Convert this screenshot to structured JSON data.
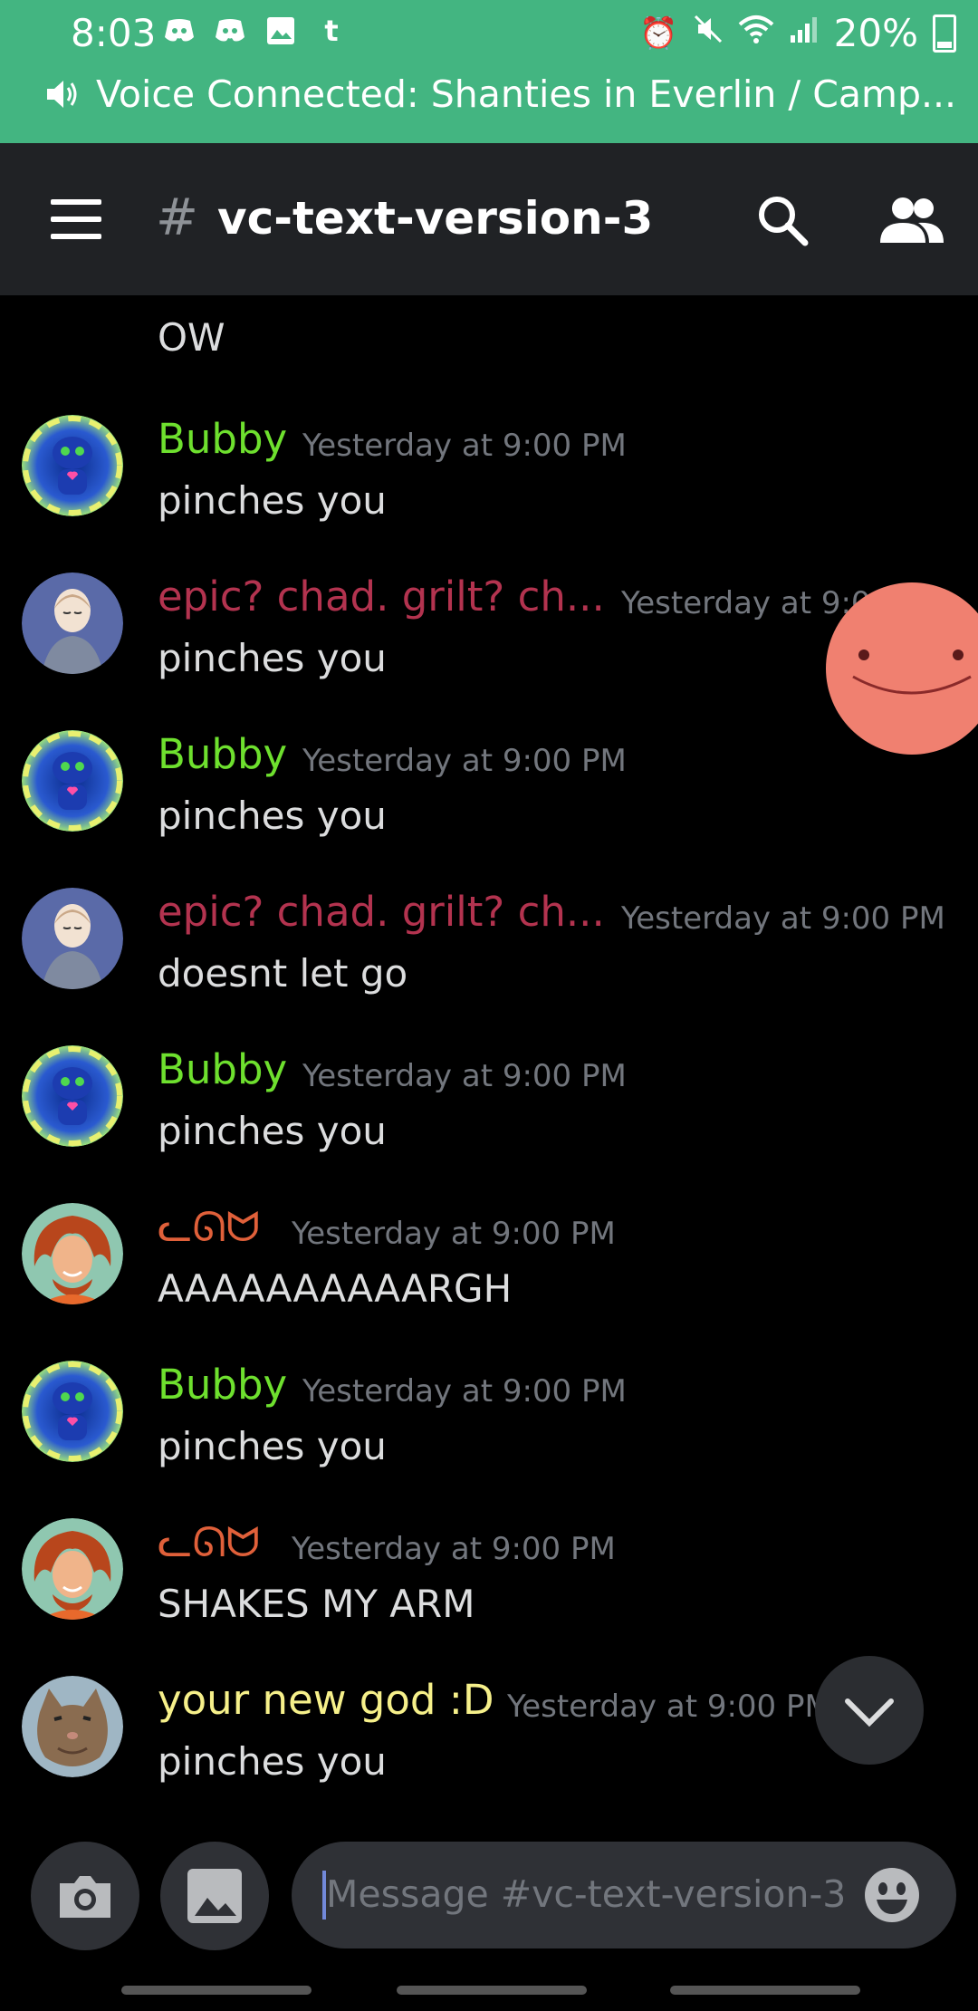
{
  "status_bar": {
    "time": "8:03",
    "battery": "20%",
    "left_icons": [
      "discord-icon",
      "discord-icon",
      "gallery-icon",
      "tumblr-icon"
    ],
    "right_icons": [
      "alarm-icon",
      "mute-icon",
      "wifi-icon",
      "signal-icon",
      "battery-icon"
    ]
  },
  "voice_bar": {
    "text": "Voice Connected: Shanties in Everlin / Camp..."
  },
  "header": {
    "hash": "#",
    "channel": "vc-text-version-3"
  },
  "messages": {
    "partial_text": "OW",
    "items": [
      {
        "author": "Bubby",
        "color": "#6ee02e",
        "timestamp": "Yesterday at 9:00 PM",
        "text": "pinches you"
      },
      {
        "author": "epic? chad. grilt? ch...",
        "color": "#b3334f",
        "timestamp": "Yesterday at 9:00 PM",
        "text": "pinches you"
      },
      {
        "author": "Bubby",
        "color": "#6ee02e",
        "timestamp": "Yesterday at 9:00 PM",
        "text": "pinches you"
      },
      {
        "author": "epic? chad. grilt? ch...",
        "color": "#b3334f",
        "timestamp": "Yesterday at 9:00 PM",
        "text": "doesnt let go"
      },
      {
        "author": "Bubby",
        "color": "#6ee02e",
        "timestamp": "Yesterday at 9:00 PM",
        "text": "pinches you"
      },
      {
        "author": "ᓚᘏᗢ",
        "color": "#e0603a",
        "timestamp": "Yesterday at 9:00 PM",
        "text": "AAAAAAAAAARGH"
      },
      {
        "author": "Bubby",
        "color": "#6ee02e",
        "timestamp": "Yesterday at 9:00 PM",
        "text": "pinches you"
      },
      {
        "author": "ᓚᘏᗢ",
        "color": "#e0603a",
        "timestamp": "Yesterday at 9:00 PM",
        "text": "SHAKES MY ARM"
      },
      {
        "author": "your new god :D",
        "color": "#f6f08a",
        "timestamp": "Yesterday at 9:00 PM",
        "text": "pinches you"
      }
    ]
  },
  "composer": {
    "placeholder": "Message #vc-text-version-3"
  }
}
